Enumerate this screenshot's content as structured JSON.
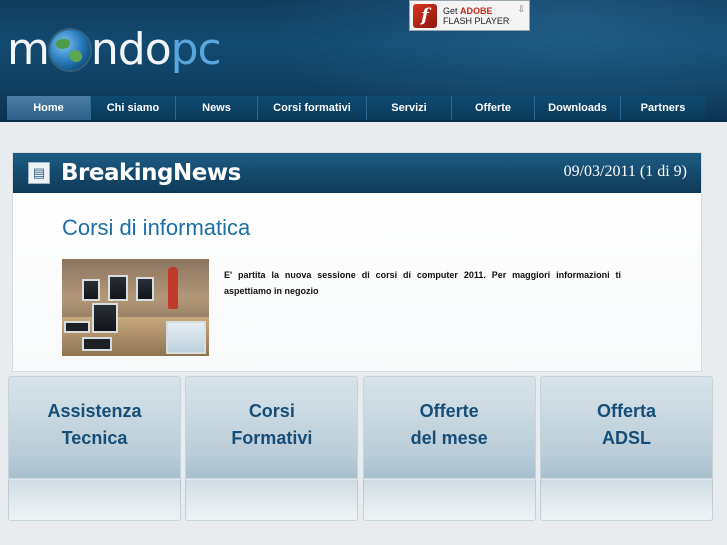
{
  "header": {
    "logo": {
      "part1": "m",
      "part2": "ndo",
      "part3": "pc"
    },
    "flash_badge": {
      "line1_prefix": "Get",
      "line1_brand": "ADOBE",
      "line2": "FLASH PLAYER",
      "icon": "flash-icon"
    }
  },
  "nav": {
    "items": [
      {
        "label": "Home",
        "active": true
      },
      {
        "label": "Chi siamo",
        "active": false
      },
      {
        "label": "News",
        "active": false
      },
      {
        "label": "Corsi formativi",
        "active": false
      },
      {
        "label": "Servizi",
        "active": false
      },
      {
        "label": "Offerte",
        "active": false
      },
      {
        "label": "Downloads",
        "active": false
      },
      {
        "label": "Partners",
        "active": false
      }
    ]
  },
  "news": {
    "title": "BreakingNews",
    "date": "09/03/2011 (1 di 9)",
    "article": {
      "title": "Corsi di informatica",
      "text": "E' partita la nuova sessione di corsi di computer 2011. Per maggiori informazioni ti aspettiamo in negozio"
    }
  },
  "tiles": [
    {
      "line1": "Assistenza",
      "line2": "Tecnica"
    },
    {
      "line1": "Corsi",
      "line2": "Formativi"
    },
    {
      "line1": "Offerte",
      "line2": "del mese"
    },
    {
      "line1": "Offerta",
      "line2": "ADSL"
    }
  ],
  "colors": {
    "header": "#124a70",
    "nav_active": "#3d7099",
    "accent_text": "#1c6fa6",
    "tile_text": "#164e77"
  }
}
